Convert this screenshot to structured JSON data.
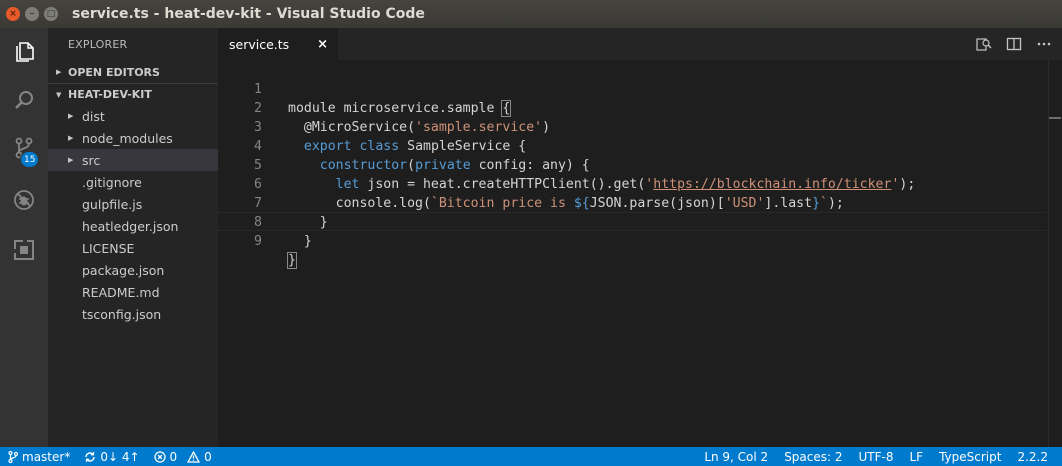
{
  "window": {
    "title": "service.ts - heat-dev-kit - Visual Studio Code",
    "close_glyph": "×",
    "minimize_glyph": "–",
    "maximize_glyph": "□"
  },
  "activity_bar": {
    "icons": [
      "files-icon",
      "search-icon",
      "source-control-icon",
      "debug-icon",
      "extensions-icon"
    ],
    "scm_badge": "15"
  },
  "sidebar": {
    "title": "EXPLORER",
    "open_editors": "OPEN EDITORS",
    "project": "HEAT-DEV-KIT",
    "folders": [
      {
        "label": "dist"
      },
      {
        "label": "node_modules"
      },
      {
        "label": "src"
      }
    ],
    "files": [
      {
        "label": ".gitignore"
      },
      {
        "label": "gulpfile.js"
      },
      {
        "label": "heatledger.json"
      },
      {
        "label": "LICENSE"
      },
      {
        "label": "package.json"
      },
      {
        "label": "README.md"
      },
      {
        "label": "tsconfig.json"
      }
    ]
  },
  "editor": {
    "tab_label": "service.ts",
    "tab_close": "×",
    "line_numbers": [
      "1",
      "2",
      "3",
      "4",
      "5",
      "6",
      "7",
      "8",
      "9"
    ],
    "code": {
      "l1": {
        "text": "module microservice.sample ",
        "brace": "{"
      },
      "l2": {
        "pre": "  @MicroService(",
        "str": "'sample.service'",
        "post": ")"
      },
      "l3": {
        "indent": "  ",
        "kw1": "export",
        "sp": " ",
        "kw2": "class",
        "rest": " SampleService {"
      },
      "l4": {
        "pre": "    ",
        "kw": "constructor",
        "mid": "(",
        "kw2": "private",
        "rest": " config: any) {"
      },
      "l5": {
        "pre": "      ",
        "kw": "let",
        "mid": " json = heat.createHTTPClient().get(",
        "q1": "'",
        "url": "https://blockchain.info/ticker",
        "q2": "'",
        "post": ");"
      },
      "l6": {
        "pre": "      console.log(",
        "str1": "`Bitcoin price is ",
        "tpl1": "${",
        "expr": "JSON.parse(json)[",
        "str2": "'USD'",
        "expr2": "].last",
        "tpl2": "}",
        "str3": "`",
        "post": ");"
      },
      "l7": {
        "text": "    }"
      },
      "l8": {
        "text": "  }"
      },
      "l9": {
        "brace": "}"
      }
    }
  },
  "status_bar": {
    "branch": "master*",
    "sync": "0↓ 4↑",
    "errors": "0",
    "warnings": "0",
    "cursor": "Ln 9, Col 2",
    "spaces": "Spaces: 2",
    "encoding": "UTF-8",
    "eol": "LF",
    "language": "TypeScript",
    "version": "2.2.2"
  },
  "colors": {
    "accent": "#007acc",
    "keyword": "#569cd6",
    "string": "#ce9178",
    "close_button": "#e45a2a"
  }
}
